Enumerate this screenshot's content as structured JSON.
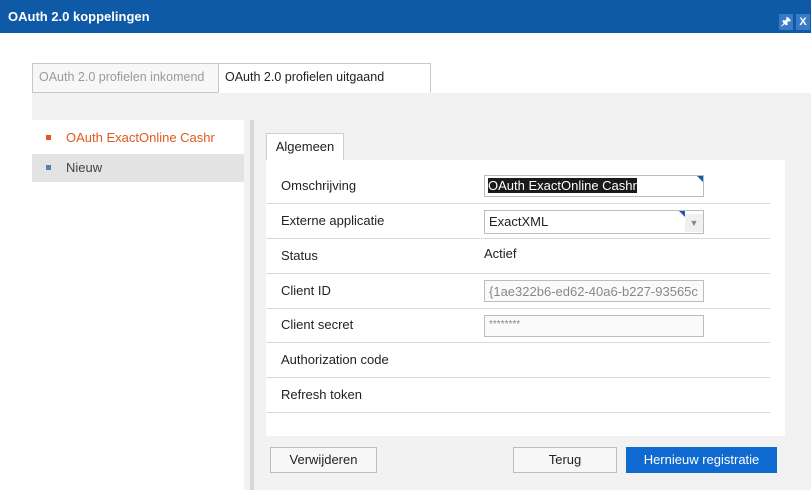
{
  "window": {
    "title": "OAuth 2.0 koppelingen",
    "pin_glyph": "🖈",
    "close_glyph": "X"
  },
  "tabs": [
    {
      "label": "OAuth 2.0 profielen inkomend",
      "active": false
    },
    {
      "label": "OAuth 2.0 profielen uitgaand",
      "active": true
    }
  ],
  "profiles": {
    "items": [
      {
        "label": "OAuth ExactOnline Cashr",
        "selected": true
      },
      {
        "label": "Nieuw",
        "selected": false
      }
    ]
  },
  "detail_tab": {
    "label": "Algemeen"
  },
  "form": {
    "omschrijving": {
      "label": "Omschrijving",
      "value": "OAuth ExactOnline Cashr"
    },
    "externe_applicatie": {
      "label": "Externe applicatie",
      "value": "ExactXML"
    },
    "status": {
      "label": "Status",
      "value": "Actief"
    },
    "client_id": {
      "label": "Client ID",
      "value": "{1ae322b6-ed62-40a6-b227-93565c"
    },
    "client_secret": {
      "label": "Client secret",
      "value": "********"
    },
    "authorization_code": {
      "label": "Authorization code"
    },
    "refresh_token": {
      "label": "Refresh token"
    }
  },
  "buttons": {
    "delete": "Verwijderen",
    "back": "Terug",
    "reregister": "Hernieuw registratie"
  },
  "colors": {
    "titlebar": "#0e5aa7",
    "accent_orange": "#e05a1e",
    "primary_button": "#0e6ad0",
    "selection_highlight": "#1a1a1a"
  }
}
